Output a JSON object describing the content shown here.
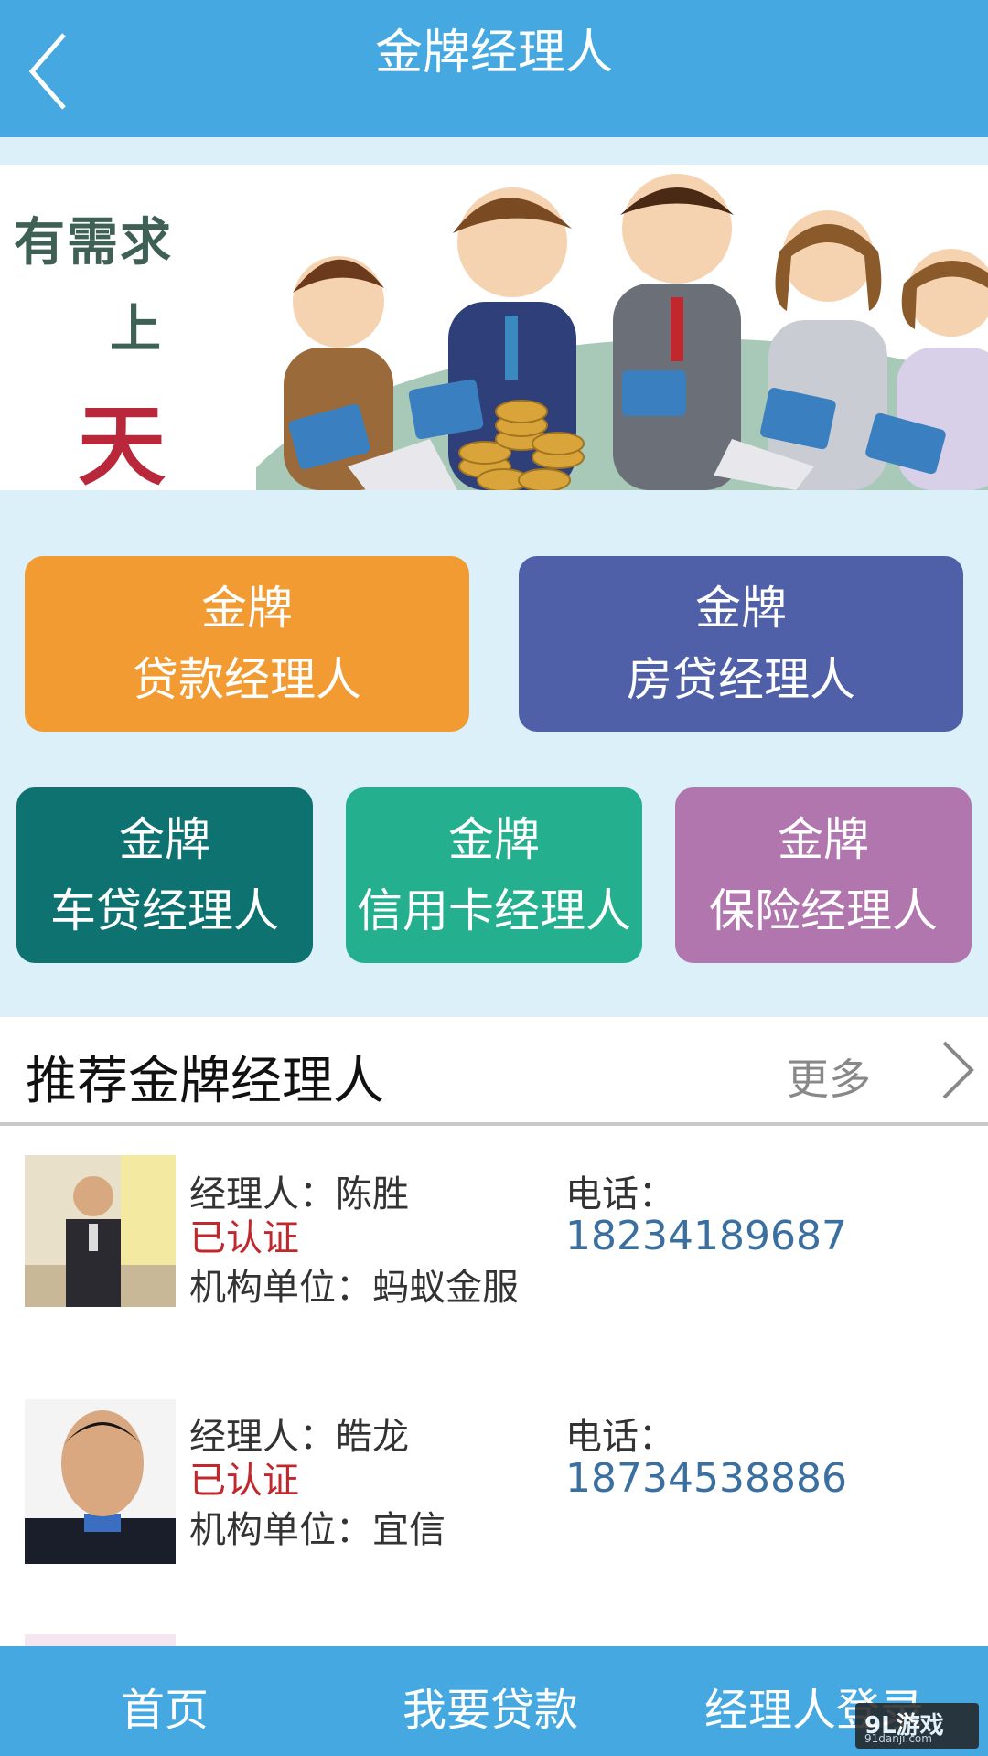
{
  "header": {
    "title": "金牌经理人"
  },
  "banner": {
    "slogan_1": "有需求",
    "slogan_2": "上",
    "slogan_3": "天马"
  },
  "categories": [
    {
      "line1": "金牌",
      "line2": "贷款经理人",
      "color": "#f29b33"
    },
    {
      "line1": "金牌",
      "line2": "房贷经理人",
      "color": "#4f60a8"
    },
    {
      "line1": "金牌",
      "line2": "车贷经理人",
      "color": "#0d7270"
    },
    {
      "line1": "金牌",
      "line2": "信用卡经理人",
      "color": "#24b08e"
    },
    {
      "line1": "金牌",
      "line2": "保险经理人",
      "color": "#b176ae"
    }
  ],
  "recommend": {
    "title": "推荐金牌经理人",
    "more": "更多"
  },
  "managers": [
    {
      "name": "经理人：陈胜",
      "status": "已认证",
      "org": "机构单位：蚂蚁金服",
      "phone_label": "电话：",
      "phone": "18234189687"
    },
    {
      "name": "经理人：皓龙",
      "status": "已认证",
      "org": "机构单位：宜信",
      "phone_label": "电话：",
      "phone": "18734538886"
    }
  ],
  "bottom_nav": {
    "home": "首页",
    "loan": "我要贷款",
    "login": "经理人登录"
  },
  "watermark": {
    "text": "9L游戏",
    "sub": "91danji.com"
  }
}
